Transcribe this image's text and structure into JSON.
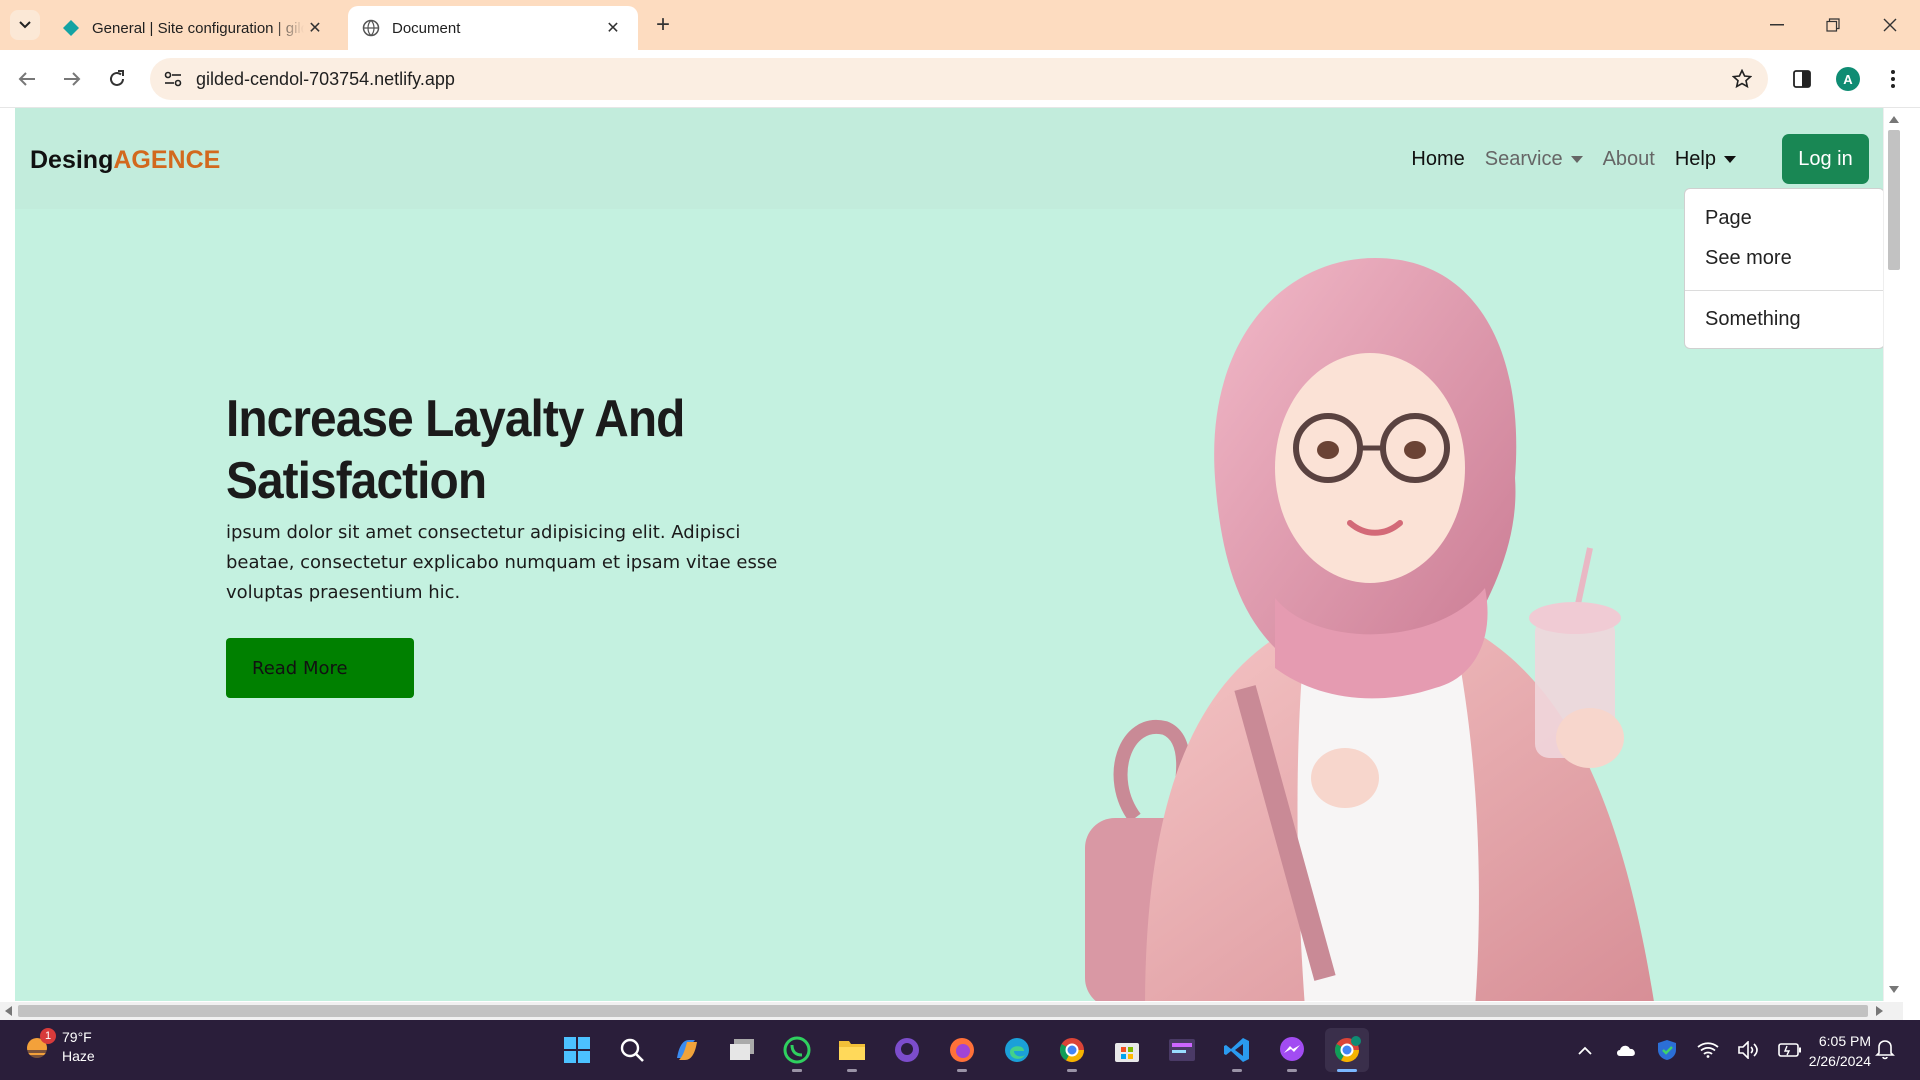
{
  "browser": {
    "tabs": [
      {
        "title": "General | Site configuration | gilded-cendol",
        "active": false,
        "favicon": "netlify-diamond-icon"
      },
      {
        "title": "Document",
        "active": true,
        "favicon": "globe-icon"
      }
    ],
    "url": "gilded-cendol-703754.netlify.app",
    "profile_initial": "A"
  },
  "site": {
    "brand": {
      "primary": "Desing",
      "accent": "AGENCE"
    },
    "nav": [
      {
        "label": "Home",
        "active": true,
        "dropdown": false
      },
      {
        "label": "Searvice",
        "active": false,
        "dropdown": true
      },
      {
        "label": "About",
        "active": false,
        "dropdown": false
      },
      {
        "label": "Help",
        "active": true,
        "dropdown": true
      }
    ],
    "login_label": "Log in",
    "dropdown_items": [
      "Page",
      "See more",
      "Something"
    ],
    "hero": {
      "title": "Increase Layalty And Satisfaction",
      "text": "ipsum dolor sit amet consectetur adipisicing elit. Adipisci beatae, consectetur explicabo numquam et ipsam vitae esse voluptas praesentium hic.",
      "button": "Read More"
    },
    "colors": {
      "background": "#c4f1e0",
      "accent": "#d2691e",
      "login": "#198754",
      "read_more": "#008000"
    }
  },
  "taskbar": {
    "weather": {
      "temp": "79°F",
      "condition": "Haze",
      "badge": "1"
    },
    "apps": [
      "windows-start-icon",
      "search-icon",
      "copilot-icon",
      "task-view-icon",
      "whatsapp-icon",
      "file-explorer-icon",
      "github-icon",
      "firefox-icon",
      "edge-icon",
      "chrome-icon",
      "microsoft-store-icon",
      "app-icon",
      "vscode-icon",
      "messenger-icon",
      "chrome-profile-icon"
    ],
    "clock": {
      "time": "6:05 PM",
      "date": "2/26/2024"
    }
  }
}
